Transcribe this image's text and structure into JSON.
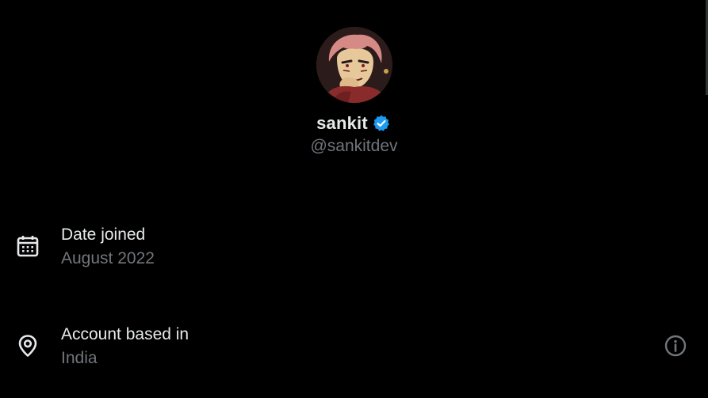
{
  "profile": {
    "display_name": "sankit",
    "handle": "@sankitdev",
    "verified": true,
    "avatar_icon": "avatar-anime-character"
  },
  "details": {
    "date_joined": {
      "label": "Date joined",
      "value": "August 2022",
      "icon": "calendar-icon"
    },
    "location": {
      "label": "Account based in",
      "value": "India",
      "icon": "location-pin-icon",
      "info_icon": "info-icon"
    }
  },
  "colors": {
    "background": "#000000",
    "primary_text": "#e7e9ea",
    "secondary_text": "#71767b",
    "verified_blue": "#1d9bf0"
  }
}
